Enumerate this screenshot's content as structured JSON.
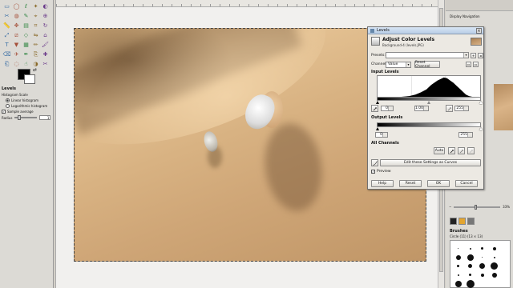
{
  "toolbox": {
    "tools": [
      "rect-select-icon",
      "ellipse-select-icon",
      "lasso-icon",
      "fuzzy-select-icon",
      "color-select-icon",
      "scissors-icon",
      "foreground-select-icon",
      "paths-icon",
      "color-picker-icon",
      "zoom-icon",
      "measure-icon",
      "move-icon",
      "align-icon",
      "crop-icon",
      "rotate-icon",
      "scale-icon",
      "shear-icon",
      "perspective-icon",
      "flip-icon",
      "cage-icon",
      "text-icon",
      "bucket-fill-icon",
      "blend-icon",
      "pencil-icon",
      "paintbrush-icon",
      "eraser-icon",
      "airbrush-icon",
      "ink-icon",
      "clone-icon",
      "heal-icon",
      "perspective-clone-icon",
      "blur-icon",
      "smudge-icon",
      "dodge-burn-icon",
      "scissors-select-icon"
    ],
    "fg_color": "#000000",
    "bg_color": "#ffffff"
  },
  "tool_options": {
    "title": "Levels",
    "histogram_scale_label": "Histogram Scale",
    "linear_label": "Linear histogram",
    "log_label": "Logarithmic histogram",
    "sample_average_label": "Sample average",
    "radius_label": "Radius",
    "radius_value": "1"
  },
  "dock": {
    "navigation_label": "Display Navigation",
    "zoom_value": "33%",
    "brushes_title": "Brushes",
    "brush_name": "Circle (11) (13 × 13)"
  },
  "levels": {
    "window_title": "Levels",
    "heading": "Adjust Color Levels",
    "subheading": "Background-4 (levels.JPG)",
    "presets_label": "Presets:",
    "channel_label": "Channel:",
    "channel_value": "Value",
    "reset_channel_label": "Reset Channel",
    "input_levels_label": "Input Levels",
    "input_low": "0",
    "input_gamma": "1.00",
    "input_high": "255",
    "output_levels_label": "Output Levels",
    "output_low": "0",
    "output_high": "255",
    "all_channels_label": "All Channels",
    "auto_label": "Auto",
    "edit_curves_label": "Edit these Settings as Curves",
    "preview_label": "Preview",
    "help_label": "Help",
    "reset_label": "Reset",
    "ok_label": "OK",
    "cancel_label": "Cancel"
  }
}
